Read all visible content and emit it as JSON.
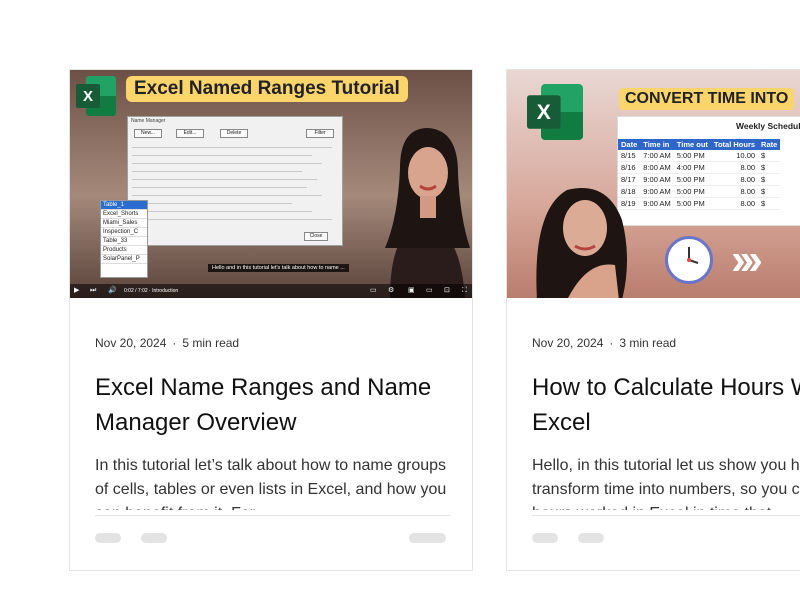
{
  "cards": [
    {
      "date": "Nov 20, 2024",
      "separator": "·",
      "read_time": "5 min read",
      "title": "Excel Name Ranges and Name Manager Overview",
      "excerpt": "In this tutorial let’s talk about how to name groups of cells, tables or even lists in Excel, and how you can benefit from it. For",
      "thumbnail": {
        "banner": "Excel Named Ranges Tutorial",
        "logo_letter": "X",
        "dialog_title": "Name Manager",
        "dialog_buttons": [
          "New...",
          "Edit...",
          "Delete",
          "Filter"
        ],
        "dialog_close": "Close",
        "range_list": [
          "Table_1",
          "Excel_Shorts",
          "Miami_Sales",
          "Inspection_C",
          "Table_33",
          "Products",
          "SolarPanel_P"
        ],
        "caption": "Hello and in this tutorial let's talk about how to name ...",
        "player_time": "0:02 / 7:02 · Introduction"
      }
    },
    {
      "date": "Nov 20, 2024",
      "separator": "·",
      "read_time": "3 min read",
      "title": "How to Calculate Hours Worked in Excel",
      "excerpt": "Hello, in this tutorial let us show you how to transform time into numbers, so you can have hours worked in Excel in time that",
      "thumbnail": {
        "banner": "CONVERT TIME INTO",
        "logo_letter": "X",
        "schedule_title": "Weekly Schedule",
        "schedule_headers": [
          "Date",
          "Time in",
          "Time out",
          "Total Hours",
          "Rate"
        ],
        "schedule_rows": [
          [
            "8/15",
            "7:00 AM",
            "5:00 PM",
            "10.00",
            "$"
          ],
          [
            "8/16",
            "8:00 AM",
            "4:00 PM",
            "8.00",
            "$"
          ],
          [
            "8/17",
            "9:00 AM",
            "5:00 PM",
            "8.00",
            "$"
          ],
          [
            "8/18",
            "9:00 AM",
            "5:00 PM",
            "8.00",
            "$"
          ],
          [
            "8/19",
            "9:00 AM",
            "5:00 PM",
            "8.00",
            "$"
          ]
        ],
        "arrows": "›››"
      }
    }
  ],
  "colors": {
    "excel_green": "#21a366",
    "banner_yellow": "#fbd46b",
    "table_header_blue": "#2f66c9",
    "divider": "#e3e3e3"
  }
}
